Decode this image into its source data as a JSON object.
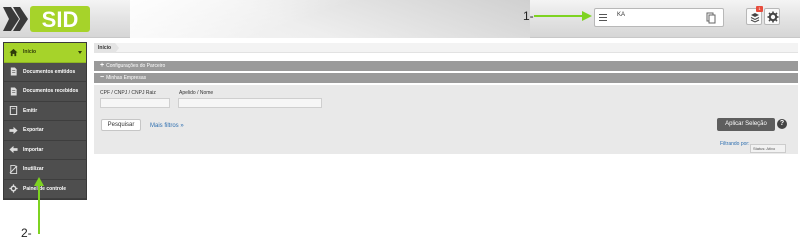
{
  "brand": {
    "logo_text": "SID",
    "accent_color": "#a6d32a"
  },
  "annotations": {
    "one": "1-",
    "two": "2-",
    "arrow_color": "#7ed321"
  },
  "header": {
    "search_value": "KA",
    "menu_icon": "menu-icon",
    "notification_count": "1"
  },
  "sidebar": {
    "items": [
      {
        "label": "Início",
        "icon": "home-icon",
        "active": true
      },
      {
        "label": "Documentos emitidos",
        "icon": "document-icon"
      },
      {
        "label": "Documentos recebidos",
        "icon": "document-icon"
      },
      {
        "label": "Emitir",
        "icon": "emit-icon"
      },
      {
        "label": "Exportar",
        "icon": "export-icon"
      },
      {
        "label": "Importar",
        "icon": "import-icon"
      },
      {
        "label": "Inutilizar",
        "icon": "disable-icon"
      },
      {
        "label": "Painel de controle",
        "icon": "gear-icon"
      }
    ]
  },
  "main": {
    "breadcrumb": "Início",
    "section_settings": "Configurações do Parceiro",
    "section_companies": "Minhas Empresas",
    "cpf_label": "CPF / CNPJ / CNPJ Raiz",
    "cpf_value": "",
    "name_label": "Apelido / Nome",
    "name_value": "",
    "search_button": "Pesquisar",
    "more_filters": "Mais filtros »",
    "apply_button": "Aplicar Seleção",
    "help": "?",
    "filter_label": "Filtrando por:",
    "filter_chip": "Status: Ativo"
  }
}
